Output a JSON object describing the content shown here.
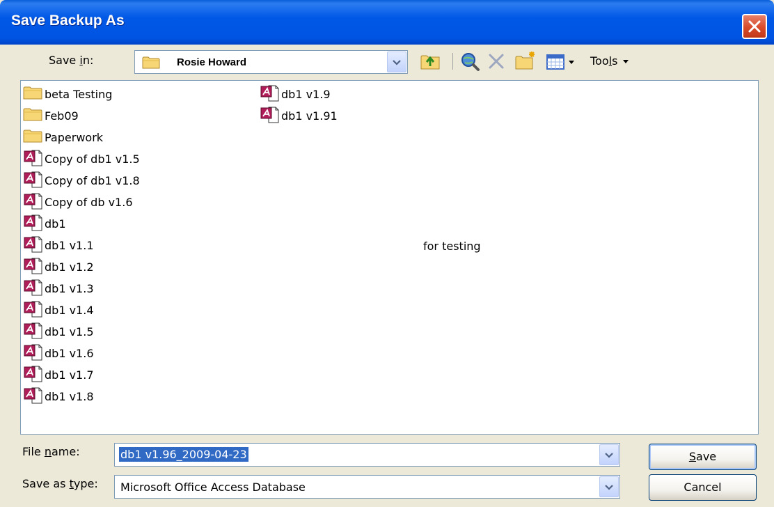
{
  "window": {
    "title": "Save Backup As"
  },
  "toolbar": {
    "save_in_pre": "Save ",
    "save_in_u": "i",
    "save_in_post": "n:",
    "save_in_value": "Rosie Howard",
    "tools_pre": "Too",
    "tools_u": "l",
    "tools_post": "s"
  },
  "files": {
    "col1": [
      {
        "name": "beta Testing",
        "type": "folder"
      },
      {
        "name": "Feb09",
        "type": "folder"
      },
      {
        "name": "Paperwork",
        "type": "folder"
      },
      {
        "name": "Copy of db1 v1.5",
        "type": "access"
      },
      {
        "name": "Copy of db1 v1.8",
        "type": "access"
      },
      {
        "name": "Copy of db v1.6",
        "type": "access"
      },
      {
        "name": "db1",
        "type": "access"
      },
      {
        "name": "db1 v1.1",
        "type": "access"
      },
      {
        "name": "db1 v1.2",
        "type": "access"
      },
      {
        "name": "db1 v1.3",
        "type": "access"
      },
      {
        "name": "db1 v1.4",
        "type": "access"
      },
      {
        "name": "db1 v1.5",
        "type": "access"
      },
      {
        "name": "db1 v1.6",
        "type": "access"
      },
      {
        "name": "db1 v1.7",
        "type": "access"
      },
      {
        "name": "db1 v1.8",
        "type": "access"
      }
    ],
    "col2": [
      {
        "name": "db1 v1.9",
        "type": "access"
      },
      {
        "name": "db1 v1.91",
        "type": "access"
      }
    ],
    "note": "for testing"
  },
  "form": {
    "file_name_pre": "File ",
    "file_name_u": "n",
    "file_name_post": "ame:",
    "file_name_value": "db1 v1.96_2009-04-23",
    "save_type_pre": "Save as ",
    "save_type_u": "t",
    "save_type_post": "ype:",
    "save_type_value": "Microsoft Office Access Database"
  },
  "buttons": {
    "save_u": "S",
    "save_post": "ave",
    "cancel": "Cancel"
  }
}
